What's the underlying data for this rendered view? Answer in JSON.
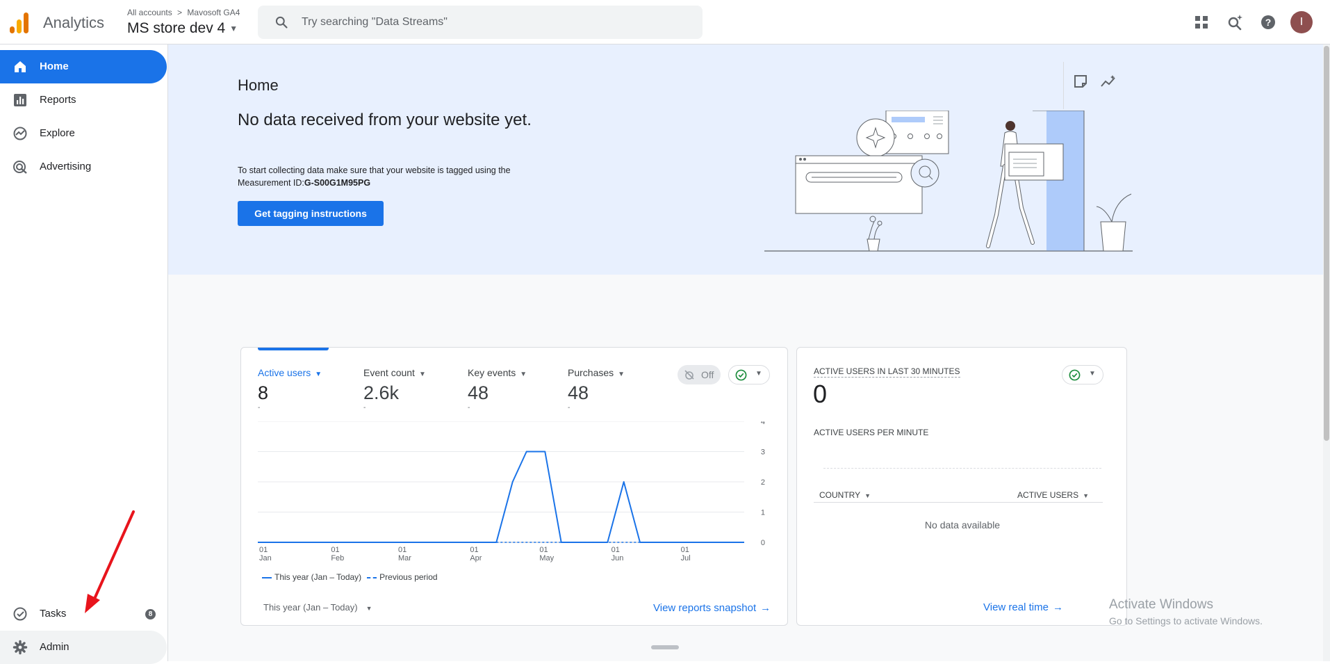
{
  "header": {
    "app_title": "Analytics",
    "breadcrumb": {
      "root": "All accounts",
      "separator": ">",
      "account": "Mavosoft GA4"
    },
    "property_name": "MS store dev 4",
    "search_placeholder": "Try searching \"Data Streams\"",
    "icons": [
      "apps-grid-icon",
      "search-insights-icon",
      "help-icon"
    ],
    "avatar_letter": "I"
  },
  "sidebar": {
    "items": [
      {
        "label": "Home",
        "icon": "home-icon",
        "active": true
      },
      {
        "label": "Reports",
        "icon": "reports-icon"
      },
      {
        "label": "Explore",
        "icon": "explore-icon"
      },
      {
        "label": "Advertising",
        "icon": "advertising-icon"
      }
    ],
    "tasks": {
      "label": "Tasks",
      "badge": "8"
    },
    "admin": {
      "label": "Admin"
    }
  },
  "hero": {
    "title": "Home",
    "headline": "No data received from your website yet.",
    "description": "To start collecting data make sure that your website is tagged using the Measurement ID:",
    "measurement_id": "G-S00G1M95PG",
    "button_label": "Get tagging instructions"
  },
  "overview_card": {
    "metrics": [
      {
        "label": "Active users",
        "value": "8",
        "delta": "-",
        "active": true
      },
      {
        "label": "Event count",
        "value": "2.6k",
        "delta": "-"
      },
      {
        "label": "Key events",
        "value": "48",
        "delta": "-"
      },
      {
        "label": "Purchases",
        "value": "48",
        "delta": "-"
      }
    ],
    "toggle_label": "Off",
    "legend": {
      "current": "This year (Jan – Today)",
      "previous": "Previous period"
    },
    "date_range": "This year (Jan – Today)",
    "link": "View reports snapshot"
  },
  "realtime_card": {
    "title": "ACTIVE USERS IN LAST 30 MINUTES",
    "value": "0",
    "subtitle": "ACTIVE USERS PER MINUTE",
    "col_country": "COUNTRY",
    "col_active_users": "ACTIVE USERS",
    "empty_text": "No data available",
    "link": "View real time"
  },
  "watermark": {
    "line1": "Activate Windows",
    "line2": "Go to Settings to activate Windows."
  },
  "colors": {
    "accent": "#1a73e8",
    "hero_bg": "#e8f0fe",
    "annotation": "#e8141c",
    "success": "#1e8e3e"
  },
  "chart_data": {
    "type": "line",
    "x_tick_labels": [
      {
        "day": "01",
        "month": "Jan"
      },
      {
        "day": "01",
        "month": "Feb"
      },
      {
        "day": "01",
        "month": "Mar"
      },
      {
        "day": "01",
        "month": "Apr"
      },
      {
        "day": "01",
        "month": "May"
      },
      {
        "day": "01",
        "month": "Jun"
      },
      {
        "day": "01",
        "month": "Jul"
      }
    ],
    "y_ticks": [
      0,
      1,
      2,
      3,
      4
    ],
    "ylim": [
      0,
      4
    ],
    "xlim": [
      "2024-01-01",
      "2024-07-29"
    ],
    "grid": true,
    "series": [
      {
        "name": "This year (Jan – Today)",
        "style": "solid",
        "points": [
          [
            "2024-01-01",
            0
          ],
          [
            "2024-04-13",
            0
          ],
          [
            "2024-04-20",
            2
          ],
          [
            "2024-04-26",
            3
          ],
          [
            "2024-05-04",
            3
          ],
          [
            "2024-05-11",
            0
          ],
          [
            "2024-05-31",
            0
          ],
          [
            "2024-06-07",
            2
          ],
          [
            "2024-06-14",
            0
          ],
          [
            "2024-07-29",
            0
          ]
        ]
      },
      {
        "name": "Previous period",
        "style": "dashed",
        "points": [
          [
            "2024-04-13",
            0
          ],
          [
            "2024-06-14",
            0
          ]
        ]
      }
    ]
  }
}
